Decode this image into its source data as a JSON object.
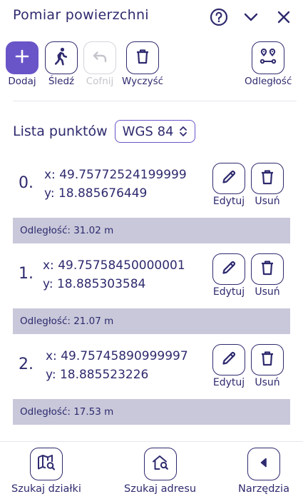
{
  "header": {
    "title": "Pomiar powierzchni"
  },
  "tools": {
    "add": "Dodaj",
    "track": "Śledź",
    "undo": "Cofnij",
    "clear": "Wyczyść",
    "distance": "Odległość"
  },
  "list": {
    "title": "Lista punktów",
    "crs_selected": "WGS 84",
    "edit_label": "Edytuj",
    "delete_label": "Usuń",
    "points": [
      {
        "index": "0.",
        "x": "x: 49.75772524199999",
        "y": "y: 18.885676449",
        "distance": "Odległość: 31.02 m"
      },
      {
        "index": "1.",
        "x": "x: 49.75758450000001",
        "y": "y: 18.885303584",
        "distance": "Odległość: 21.07 m"
      },
      {
        "index": "2.",
        "x": "x: 49.75745890999997",
        "y": "y: 18.885523226",
        "distance": "Odległość: 17.53 m"
      }
    ]
  },
  "bottom_nav": {
    "parcel": "Szukaj działki",
    "address": "Szukaj adresu",
    "tools": "Narzędzia"
  },
  "colors": {
    "accent": "#6a55c8",
    "text": "#2e2a6e",
    "band": "#c8c8da"
  }
}
